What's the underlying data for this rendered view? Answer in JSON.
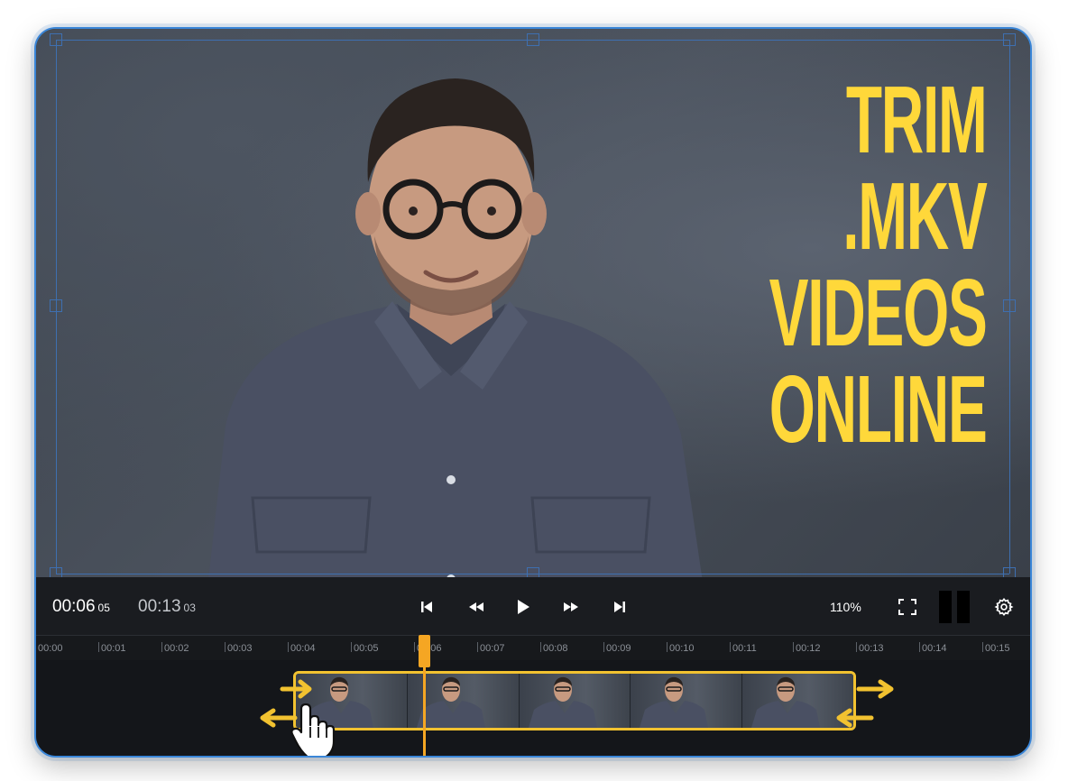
{
  "headline": {
    "line1": "TRIM",
    "line2": ".MKV",
    "line3": "VIDEOS",
    "line4": "ONLINE"
  },
  "player": {
    "current_time": "00:06",
    "current_frames": "05",
    "duration": "00:13",
    "duration_frames": "03",
    "zoom": "110%"
  },
  "icons": {
    "skip_start": "skip-start-icon",
    "rewind": "rewind-icon",
    "play": "play-icon",
    "fast_forward": "fast-forward-icon",
    "skip_end": "skip-end-icon",
    "fullscreen": "fullscreen-icon",
    "split": "split-view-icon",
    "settings": "gear-icon",
    "trim_left": "arrow-left-right-icon",
    "trim_right": "arrow-left-right-icon",
    "cursor": "hand-cursor-icon"
  },
  "colors": {
    "accent": "#ffd83a",
    "clip_border": "#f2c230",
    "playhead": "#f5a623",
    "selection": "#3e6fb0"
  },
  "ruler": {
    "ticks": [
      "00:00",
      "00:01",
      "00:02",
      "00:03",
      "00:04",
      "00:05",
      "00:06",
      "00:07",
      "00:08",
      "00:09",
      "00:10",
      "00:11",
      "00:12",
      "00:13",
      "00:14",
      "00:15"
    ]
  }
}
